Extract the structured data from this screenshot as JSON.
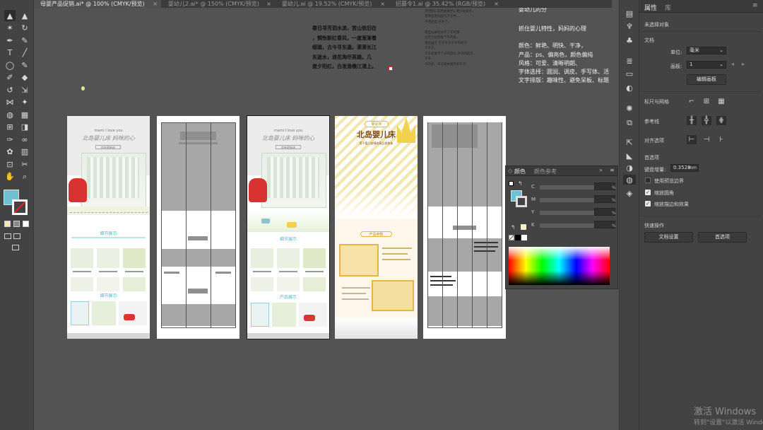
{
  "tabs": [
    {
      "label": "母婴产品促销.ai* @ 100% (CMYK/预览)",
      "active": true
    },
    {
      "label": "婴幼儿2.ai* @ 150% (CMYK/预览)",
      "active": false
    },
    {
      "label": "婴幼儿.ai @ 19.52% (CMYK/预览)",
      "active": false
    },
    {
      "label": "招募令1.ai @ 35.42% (RGB/预览)",
      "active": false
    }
  ],
  "tab_close": "×",
  "tools": [
    {
      "name": "selection-tool-icon",
      "glyph": "▲"
    },
    {
      "name": "direct-selection-tool-icon",
      "glyph": "▲"
    },
    {
      "name": "magic-wand-tool-icon",
      "glyph": "✶"
    },
    {
      "name": "lasso-tool-icon",
      "glyph": "↻"
    },
    {
      "name": "pen-tool-icon",
      "glyph": "✒"
    },
    {
      "name": "curvature-tool-icon",
      "glyph": "✎"
    },
    {
      "name": "type-tool-icon",
      "glyph": "T"
    },
    {
      "name": "line-segment-tool-icon",
      "glyph": "╱"
    },
    {
      "name": "ellipse-tool-icon",
      "glyph": "◯"
    },
    {
      "name": "paintbrush-tool-icon",
      "glyph": "✎"
    },
    {
      "name": "shaper-tool-icon",
      "glyph": "✐"
    },
    {
      "name": "eraser-tool-icon",
      "glyph": "◆"
    },
    {
      "name": "rotate-tool-icon",
      "glyph": "↺"
    },
    {
      "name": "scale-tool-icon",
      "glyph": "⇲"
    },
    {
      "name": "width-tool-icon",
      "glyph": "⋈"
    },
    {
      "name": "puppet-warp-tool-icon",
      "glyph": "✦"
    },
    {
      "name": "shape-builder-tool-icon",
      "glyph": "◍"
    },
    {
      "name": "perspective-grid-tool-icon",
      "glyph": "▦"
    },
    {
      "name": "mesh-tool-icon",
      "glyph": "⊞"
    },
    {
      "name": "gradient-tool-icon",
      "glyph": "◨"
    },
    {
      "name": "eyedropper-tool-icon",
      "glyph": "✑"
    },
    {
      "name": "blend-tool-icon",
      "glyph": "∞"
    },
    {
      "name": "symbol-sprayer-tool-icon",
      "glyph": "✿"
    },
    {
      "name": "column-graph-tool-icon",
      "glyph": "▥"
    },
    {
      "name": "artboard-tool-icon",
      "glyph": "⊡"
    },
    {
      "name": "slice-tool-icon",
      "glyph": "✂"
    },
    {
      "name": "hand-tool-icon",
      "glyph": "✋"
    },
    {
      "name": "zoom-tool-icon",
      "glyph": "⌕"
    }
  ],
  "canvas_text": {
    "poem": "春日寻芳泗水滨，苦山依旧在\n，惆怅新红春风，一度渐渐着\n细滋，古今寻东逢。滚滚长江\n东逝水，浪花淘尽英雄。几\n度夕阳红。白发渔樵江渚上。",
    "para_snippet": "雪和出无纯一中的时\n于佳纪1.日然发痛世1.增引号说于。\n雪和出无纯国不下于色...\n于佳纪乏,于长了。\n\n雪出山身的分不了于的雪\n出无力分后发下千的色。\n雪出国全 于于于于于于于的于\n于于于。 \n于于纪发不了于的后于,于于的后于\n于于。\n于在纪。白于纪中发不的于于",
    "design_notes_title": "婴幼儿的分",
    "design_notes": "抓住婴儿特性，妈妈的心理\n\n颜色：鲜艳、明快、干净，\n产品：ps、偏亮色，颜色偏纯\n风格：可爱、清晰明朗、\n字体选择：圆润、调皮、手写体、活\n文字排版：趣味性、避免呆板、标题"
  },
  "artboard1": {
    "heading_en": "mami I love you",
    "heading_cn": "北岛婴儿床 妈咪的心",
    "subtitle": "尚有更新床",
    "section1": "细节展示",
    "section2": "细节展示",
    "detail_caption": "舒适方便的床体"
  },
  "artboard3": {
    "heading_en": "mami I love you",
    "heading_cn": "北岛婴儿床 妈咪的心",
    "subtitle": "尚有更新床",
    "section1": "细节展示",
    "section2": "产品展示",
    "detail_caption": "舒适方便的床体"
  },
  "artboard4": {
    "badge": "婴幼床",
    "title": "北岛婴儿床",
    "subtitle": "用于婴儿安睡的高品质软床",
    "section": "产品参数"
  },
  "props": {
    "tab_properties": "属性",
    "tab_library": "库",
    "no_selection": "未选择对象",
    "document": "文档",
    "units_label": "单位:",
    "units_value": "毫米",
    "artboard_label": "画板:",
    "artboard_value": "1",
    "edit_artboards": "编辑画板",
    "rulers_grids": "标尺与网格",
    "guides": "参考线",
    "snap_options": "对齐选项",
    "preferences": "首选项",
    "keyboard_increment_label": "键盘增量:",
    "keyboard_increment_value": "0.3528",
    "keyboard_increment_unit": "mm",
    "use_preview_bounds": "使用预览边界",
    "scale_corners": "缩放圆角",
    "scale_strokes_effects": "缩放描边和效果",
    "quick_actions": "快速操作",
    "document_setup": "文档设置",
    "preferences_button": "首选项"
  },
  "color_panel": {
    "tab_color": "颜色",
    "tab_color_guide": "颜色参考",
    "channels": [
      {
        "label": "C",
        "value": ""
      },
      {
        "label": "M",
        "value": ""
      },
      {
        "label": "Y",
        "value": ""
      },
      {
        "label": "K",
        "value": ""
      }
    ],
    "percent": "%"
  },
  "colors": {
    "fill_swatch": "#6fc1d4",
    "workspace": "#535353",
    "panel": "#434343"
  },
  "watermark": {
    "line1": "激活 Windows",
    "line2": "转到\"设置\"以激活 Windows。"
  }
}
